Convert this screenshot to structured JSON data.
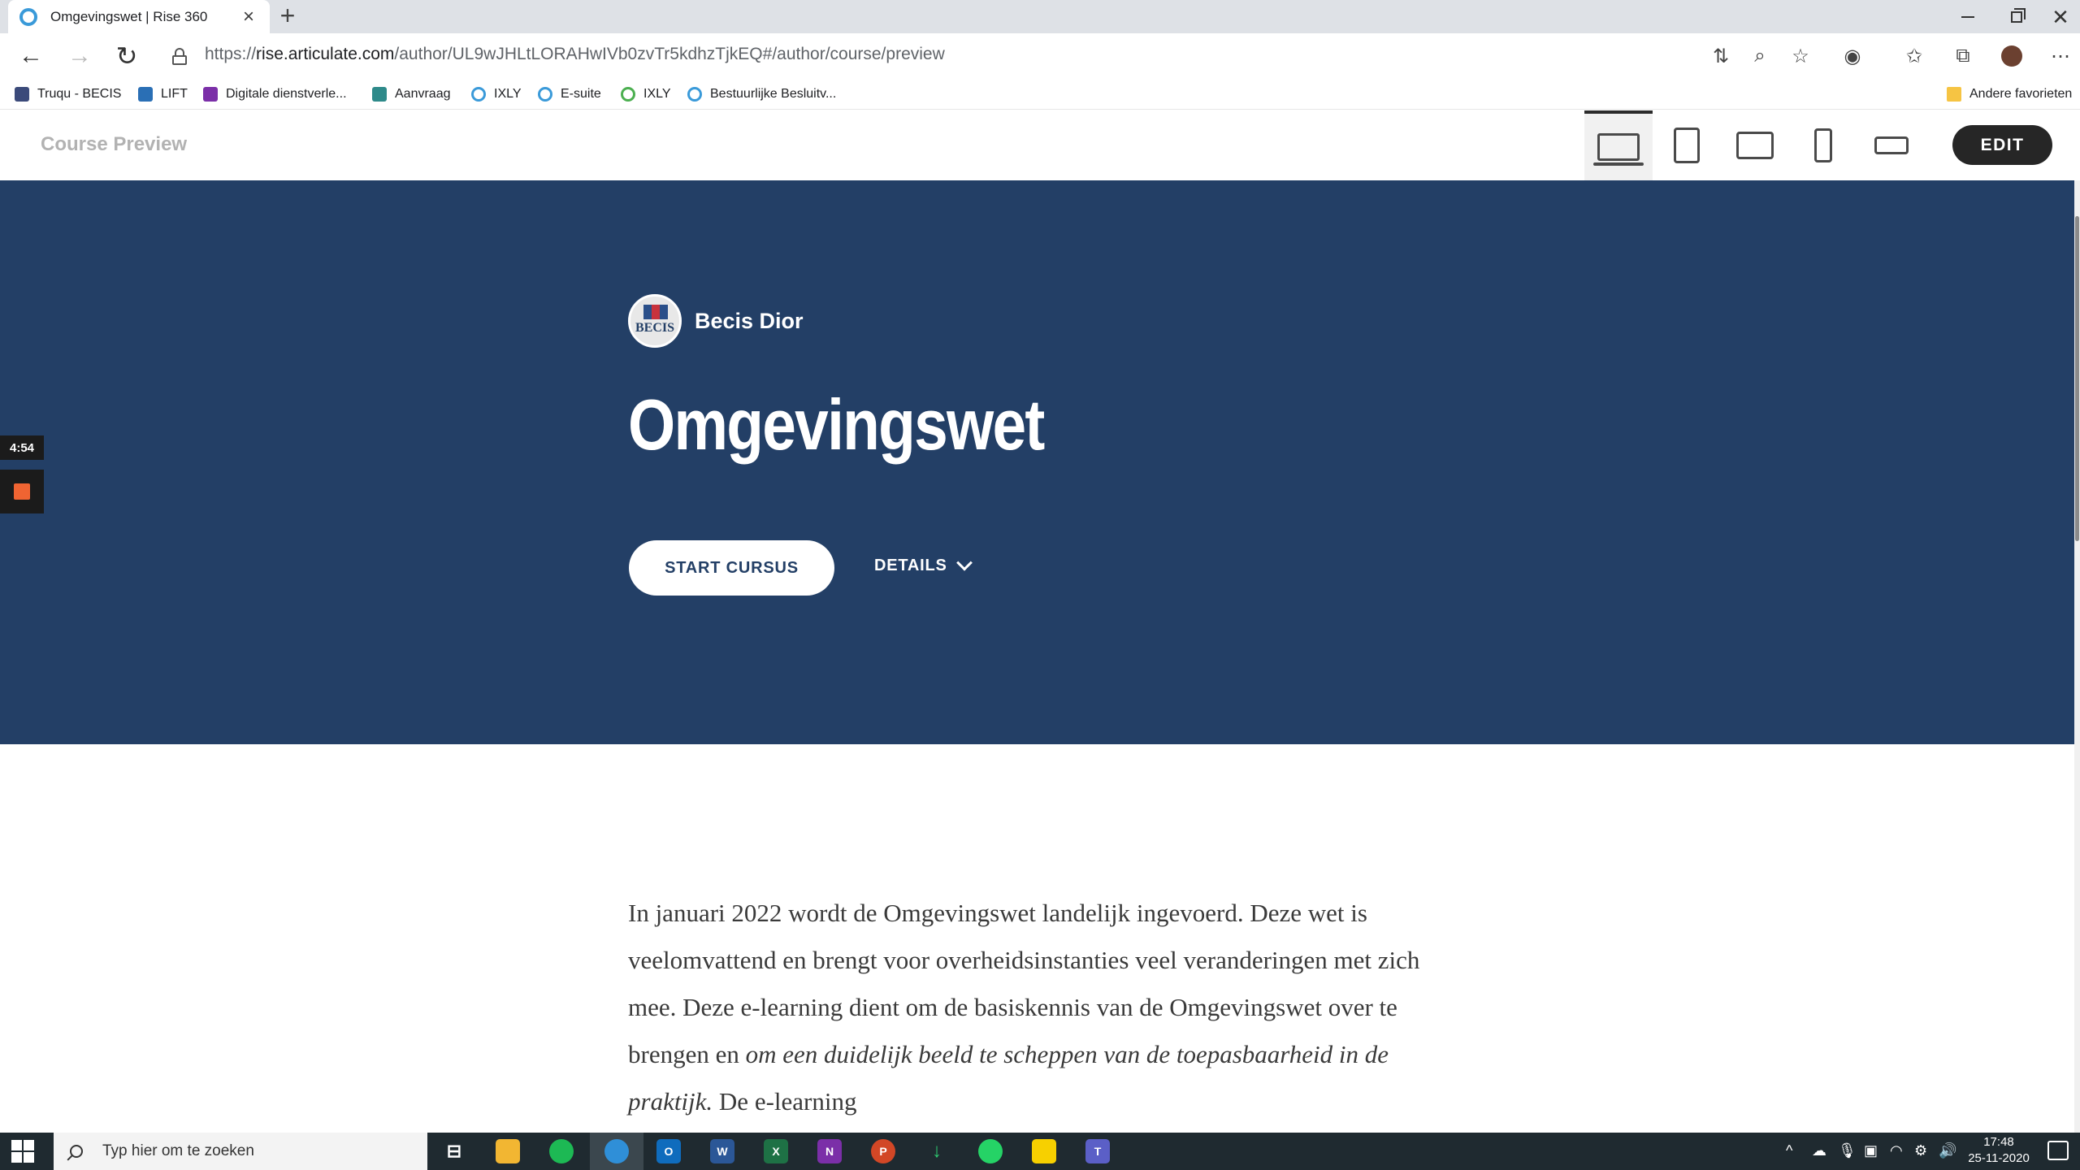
{
  "browser": {
    "tab_title": "Omgevingswet | Rise 360",
    "url_prefix": "https://",
    "url_host": "rise.articulate.com",
    "url_path": "/author/UL9wJHLtLORAHwIVb0zvTr5kdhzTjkEQ#/author/course/preview",
    "bookmarks": [
      {
        "label": "Truqu - BECIS",
        "color": "#3b4a7a"
      },
      {
        "label": "LIFT",
        "color": "#2a6fb5"
      },
      {
        "label": "Digitale dienstverle...",
        "color": "#7b2fa8"
      },
      {
        "label": "Aanvraag",
        "color": "#2e8a8a"
      },
      {
        "label": "IXLY",
        "color": "#3a9ad9"
      },
      {
        "label": "E-suite",
        "color": "#3a9ad9"
      },
      {
        "label": "IXLY",
        "color": "#4caf50"
      },
      {
        "label": "Bestuurlijke Besluitv...",
        "color": "#3a9ad9"
      }
    ],
    "other_favorites": "Andere favorieten"
  },
  "preview": {
    "title": "Course Preview",
    "edit_label": "EDIT",
    "devices": [
      "desktop",
      "tablet-portrait",
      "tablet-landscape",
      "phone-portrait",
      "phone-landscape"
    ],
    "active_device": "desktop"
  },
  "hero": {
    "brand_name": "Becis Dior",
    "logo_text": "BECIS",
    "course_title": "Omgevingswet",
    "start_label": "START CURSUS",
    "details_label": "DETAILS",
    "background": "#233f66"
  },
  "recorder": {
    "time": "4:54",
    "stop_color": "#f06432"
  },
  "body": {
    "intro_part1": "In januari 2022 wordt de Omgevingswet landelijk ingevoerd. Deze wet is veelomvattend en brengt voor overheidsinstanties veel veranderingen met zich mee. Deze e-learning dient om de basiskennis van de Omgevingswet over te brengen en ",
    "intro_italic": "om een duidelijk beeld te scheppen van de toepasbaarheid in de praktijk.",
    "intro_part2": " De e-learning"
  },
  "taskbar": {
    "search_placeholder": "Typ hier om te zoeken",
    "time": "17:48",
    "date": "25-11-2020"
  }
}
